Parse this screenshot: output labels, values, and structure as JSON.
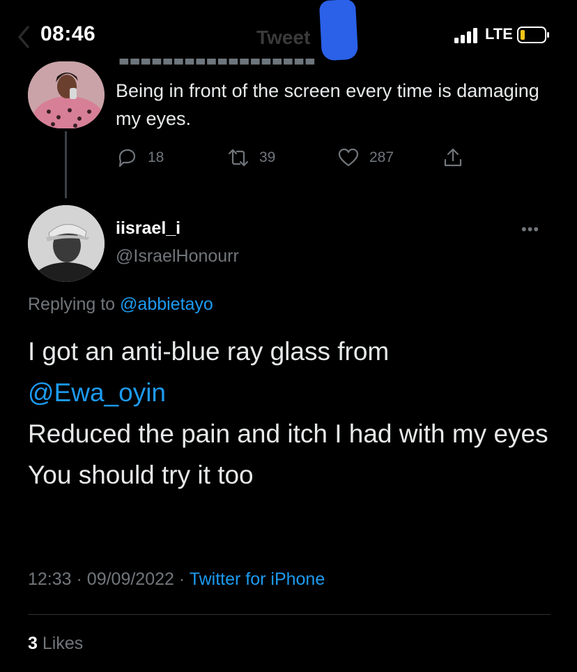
{
  "status_bar": {
    "time": "08:46",
    "network": "LTE"
  },
  "nav": {
    "title": "Tweet"
  },
  "parent_tweet": {
    "text": "Being in front of the screen every time is damaging my eyes.",
    "reply_count": "18",
    "retweet_count": "39",
    "like_count": "287"
  },
  "tweet": {
    "display_name": "iisrael_i",
    "handle": "@IsraelHonourr",
    "replying_prefix": "Replying to",
    "replying_to": "@abbietayo",
    "line1": "I got an anti-blue ray glass from",
    "mention": "@Ewa_oyin",
    "line2": "Reduced the pain and itch I had with my eyes",
    "line3": "You should try it too",
    "time": "12:33",
    "date": "09/09/2022",
    "source": "Twitter for iPhone",
    "likes_count": "3",
    "likes_label": "Likes"
  },
  "colors": {
    "background": "#000000",
    "accent": "#1d9bf0",
    "muted": "#71767b",
    "text": "#e7e9ea"
  },
  "icons": [
    "back-chevron-icon",
    "signal-icon",
    "battery-icon",
    "reply-icon",
    "retweet-icon",
    "like-icon",
    "share-icon",
    "more-icon"
  ]
}
